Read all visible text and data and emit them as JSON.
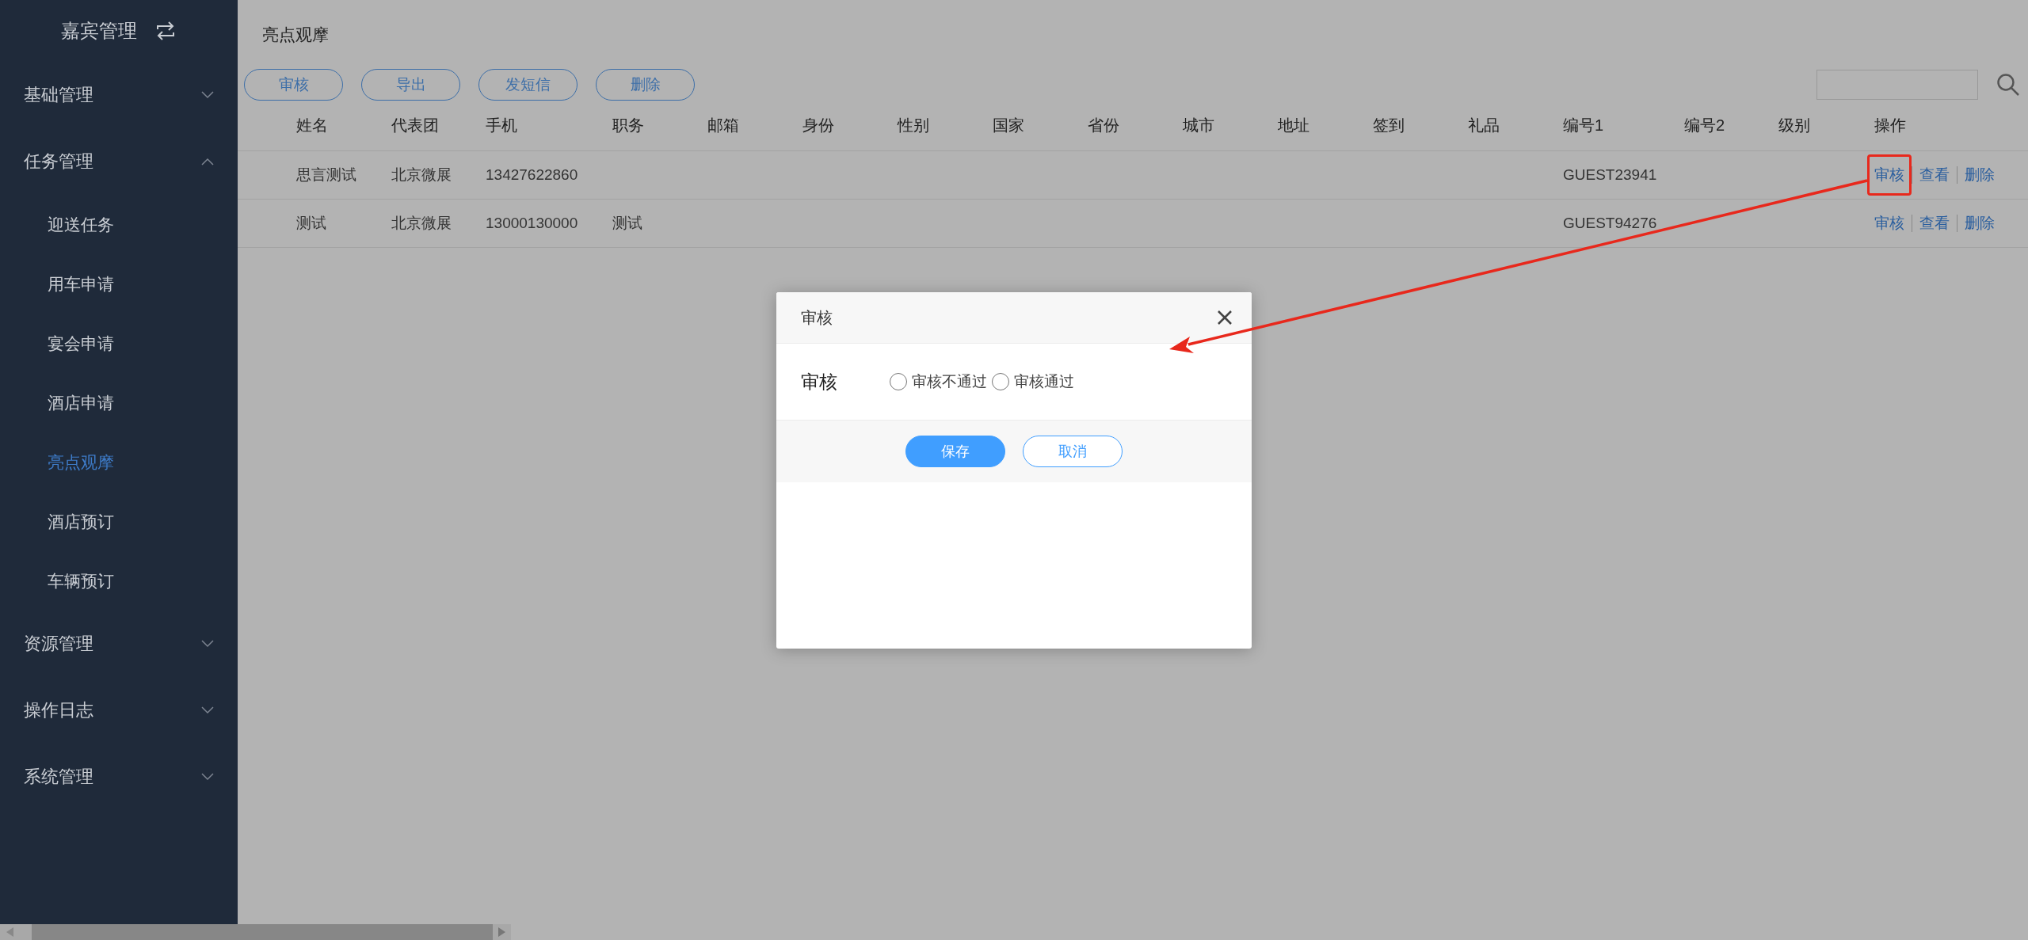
{
  "sidebar": {
    "title": "嘉宾管理",
    "items": [
      {
        "label": "基础管理",
        "expanded": false
      },
      {
        "label": "任务管理",
        "expanded": true,
        "children": [
          {
            "label": "迎送任务",
            "selected": false
          },
          {
            "label": "用车申请",
            "selected": false
          },
          {
            "label": "宴会申请",
            "selected": false
          },
          {
            "label": "酒店申请",
            "selected": false
          },
          {
            "label": "亮点观摩",
            "selected": true
          },
          {
            "label": "酒店预订",
            "selected": false
          },
          {
            "label": "车辆预订",
            "selected": false
          }
        ]
      },
      {
        "label": "资源管理",
        "expanded": false
      },
      {
        "label": "操作日志",
        "expanded": false
      },
      {
        "label": "系统管理",
        "expanded": false
      }
    ]
  },
  "page": {
    "title": "亮点观摩"
  },
  "toolbar": {
    "buttons": [
      "审核",
      "导出",
      "发短信",
      "删除"
    ]
  },
  "table": {
    "columns": [
      "姓名",
      "代表团",
      "手机",
      "职务",
      "邮箱",
      "身份",
      "性别",
      "国家",
      "省份",
      "城市",
      "地址",
      "签到",
      "礼品",
      "编号1",
      "编号2",
      "级别",
      "操作"
    ],
    "rows": [
      {
        "name": "思言测试",
        "delegation": "北京微展",
        "phone": "13427622860",
        "code1": "GUEST23941",
        "actions": [
          {
            "label": "审核",
            "highlighted": true
          },
          {
            "label": "查看",
            "highlighted": false
          },
          {
            "label": "删除",
            "highlighted": false
          }
        ]
      },
      {
        "name": "测试",
        "delegation": "北京微展",
        "phone": "13000130000",
        "position": "测试",
        "code1": "GUEST94276",
        "actions": [
          {
            "label": "审核",
            "highlighted": false
          },
          {
            "label": "查看",
            "highlighted": false
          },
          {
            "label": "删除",
            "highlighted": false
          }
        ]
      }
    ]
  },
  "dialog": {
    "title": "审核",
    "field_label": "审核",
    "options": [
      {
        "label": "审核不通过",
        "selected": false
      },
      {
        "label": "审核通过",
        "selected": false
      }
    ],
    "buttons": [
      {
        "label": "保存",
        "kind": "primary"
      },
      {
        "label": "取消",
        "kind": "secondary"
      }
    ]
  }
}
